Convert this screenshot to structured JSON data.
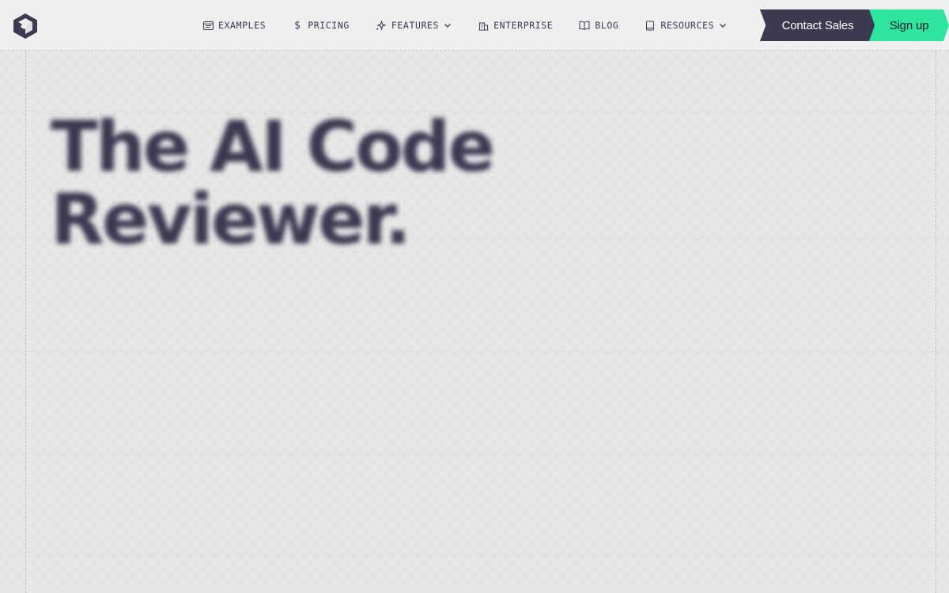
{
  "nav": {
    "items": [
      {
        "label": "EXAMPLES",
        "icon": "browser-window-icon",
        "has_dropdown": false
      },
      {
        "label": "PRICING",
        "icon": "dollar-icon",
        "has_dropdown": false
      },
      {
        "label": "FEATURES",
        "icon": "sparkle-icon",
        "has_dropdown": true
      },
      {
        "label": "ENTERPRISE",
        "icon": "building-icon",
        "has_dropdown": false
      },
      {
        "label": "BLOG",
        "icon": "open-book-icon",
        "has_dropdown": false
      },
      {
        "label": "RESOURCES",
        "icon": "book-icon",
        "has_dropdown": true
      }
    ],
    "contact_label": "Contact Sales",
    "signup_label": "Sign up"
  },
  "hero": {
    "line1": "The AI Code",
    "line2": "Reviewer."
  },
  "colors": {
    "ink": "#3b3850",
    "contact_bg": "#3c3a50",
    "signup_bg": "#2ee59d",
    "page_bg": "#e6e6e6"
  }
}
